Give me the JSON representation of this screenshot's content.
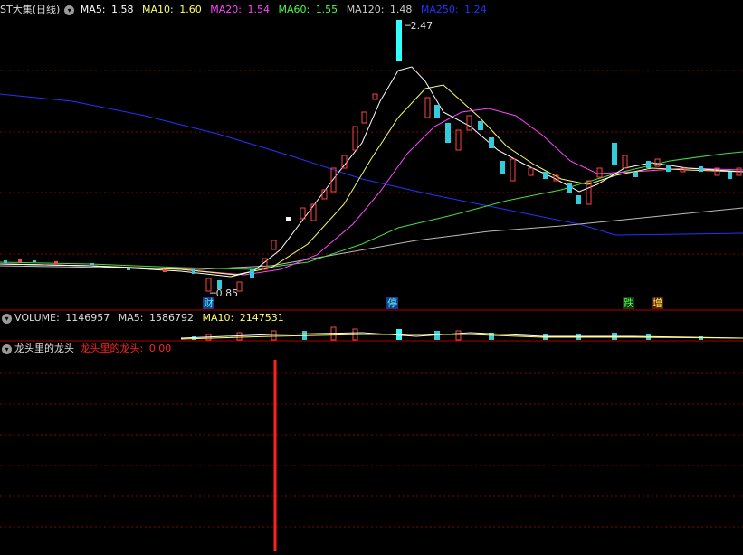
{
  "main": {
    "title": "ST大集(日线)",
    "ma5": {
      "label": "MA5:",
      "value": "1.58",
      "color": "#ffffff"
    },
    "ma10": {
      "label": "MA10:",
      "value": "1.60",
      "color": "#ffff66"
    },
    "ma20": {
      "label": "MA20:",
      "value": "1.54",
      "color": "#ff44ff"
    },
    "ma60": {
      "label": "MA60:",
      "value": "1.55",
      "color": "#44ff44"
    },
    "ma120": {
      "label": "MA120:",
      "value": "1.48",
      "color": "#cccccc"
    },
    "ma250": {
      "label": "MA250:",
      "value": "1.24",
      "color": "#2233ff"
    },
    "high_label": "2.47",
    "low_label": "0.85",
    "markers": [
      {
        "text": "财",
        "color": "#44ffff",
        "bg": "#1a3a8a"
      },
      {
        "text": "停",
        "color": "#44ffff",
        "bg": "#1a3a8a"
      },
      {
        "text": "跌",
        "color": "#44ff44",
        "bg": "#1a3a1a"
      },
      {
        "text": "增",
        "color": "#ffff44",
        "bg": "#5a1a1a"
      }
    ]
  },
  "volume": {
    "label": "VOLUME:",
    "value": "1146957",
    "ma5_label": "MA5:",
    "ma5_value": "1586792",
    "ma10_label": "MA10:",
    "ma10_value": "2147531"
  },
  "indicator": {
    "name": "龙头里的龙头",
    "series_label": "龙头里的龙头:",
    "value": "0.00",
    "color": "#ff2222"
  },
  "chart_data": {
    "type": "candlestick",
    "price_range": [
      0.85,
      2.47
    ],
    "series": [
      {
        "name": "MA5",
        "color": "#ffffff",
        "value": 1.58
      },
      {
        "name": "MA10",
        "color": "#ffff66",
        "value": 1.6
      },
      {
        "name": "MA20",
        "color": "#ff44ff",
        "value": 1.54
      },
      {
        "name": "MA60",
        "color": "#44ff44",
        "value": 1.55
      },
      {
        "name": "MA120",
        "color": "#cccccc",
        "value": 1.48
      },
      {
        "name": "MA250",
        "color": "#2233ff",
        "value": 1.24
      }
    ]
  }
}
